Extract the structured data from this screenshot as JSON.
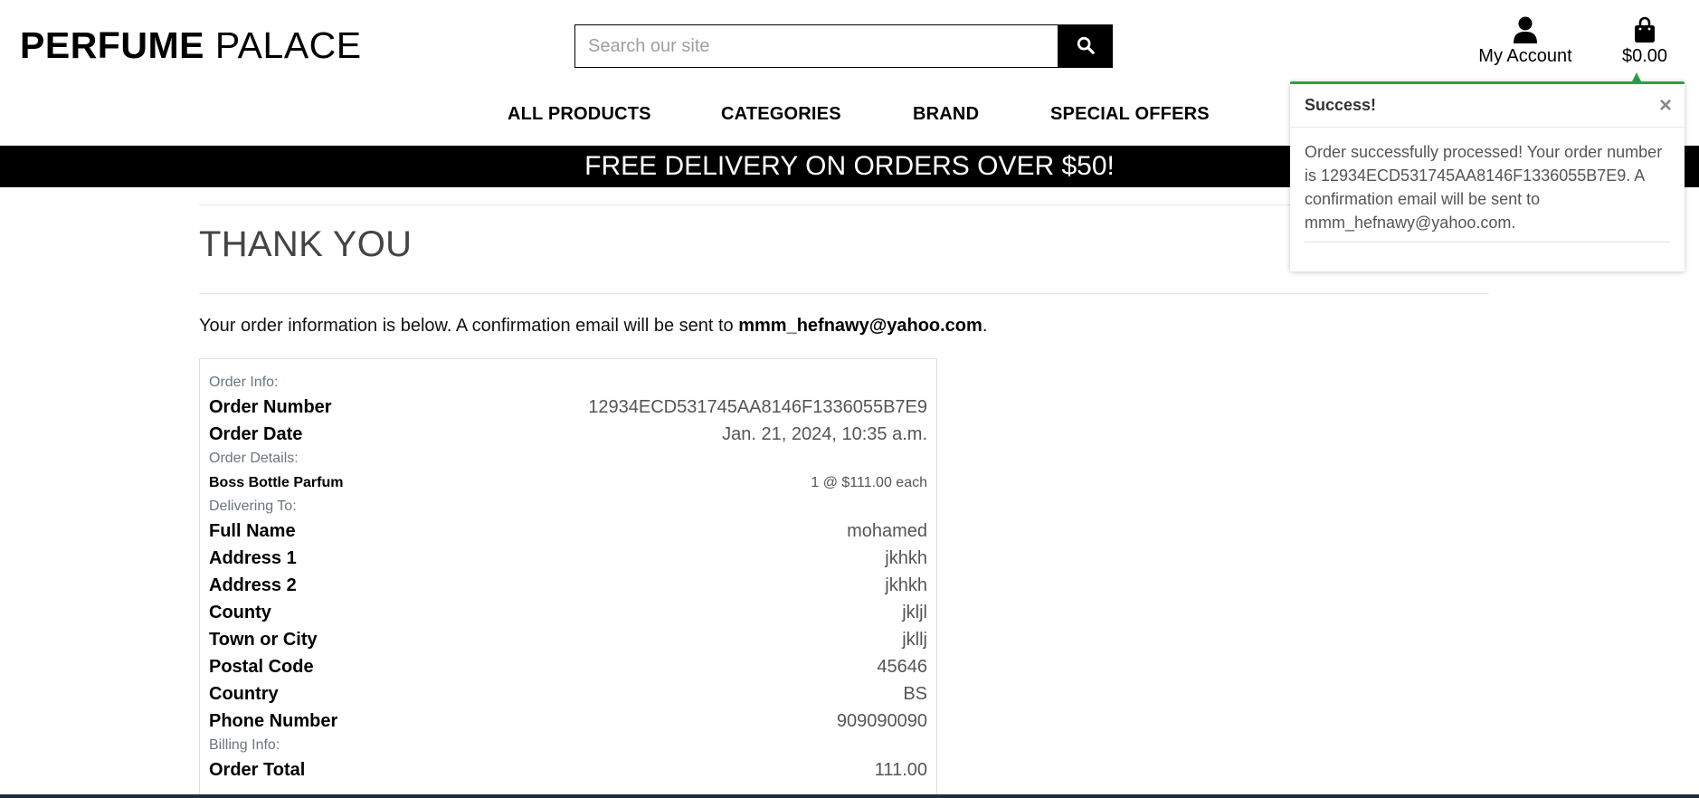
{
  "logo": {
    "bold": "PERFUME",
    "light": "PALACE"
  },
  "search": {
    "placeholder": "Search our site"
  },
  "account": {
    "label": "My Account"
  },
  "cart": {
    "total": "$0.00"
  },
  "nav": {
    "items": [
      {
        "label": "ALL PRODUCTS"
      },
      {
        "label": "CATEGORIES"
      },
      {
        "label": "BRAND"
      },
      {
        "label": "SPECIAL OFFERS"
      }
    ]
  },
  "banner": {
    "text": "FREE DELIVERY ON ORDERS OVER $50!"
  },
  "page": {
    "title": "THANK YOU",
    "intro_prefix": "Your order information is below. A confirmation email will be sent to ",
    "intro_email": "mmm_hefnawy@yahoo.com",
    "intro_suffix": "."
  },
  "order": {
    "info_label": "Order Info:",
    "number_label": "Order Number",
    "number": "12934ECD531745AA8146F1336055B7E9",
    "date_label": "Order Date",
    "date": "Jan. 21, 2024, 10:35 a.m.",
    "details_label": "Order Details:",
    "item_name": "Boss Bottle Parfum",
    "item_qty": "1 @ $111.00 each",
    "delivering_label": "Delivering To:",
    "full_name_label": "Full Name",
    "full_name": "mohamed",
    "address1_label": "Address 1",
    "address1": "jkhkh",
    "address2_label": "Address 2",
    "address2": "jkhkh",
    "county_label": "County",
    "county": "jkljl",
    "town_label": "Town or City",
    "town": "jkllj",
    "postal_label": "Postal Code",
    "postal": "45646",
    "country_label": "Country",
    "country": "BS",
    "phone_label": "Phone Number",
    "phone": "909090090",
    "billing_label": "Billing Info:",
    "total_label": "Order Total",
    "total": "111.00"
  },
  "toast": {
    "title": "Success!",
    "close": "×",
    "message": "Order successfully processed! Your order number is 12934ECD531745AA8146F1336055B7E9. A confirmation email will be sent to mmm_hefnawy@yahoo.com.",
    "accent_color": "#2aa14b"
  },
  "icons": [
    "search-icon",
    "user-icon",
    "shopping-bag-icon",
    "close-icon"
  ]
}
